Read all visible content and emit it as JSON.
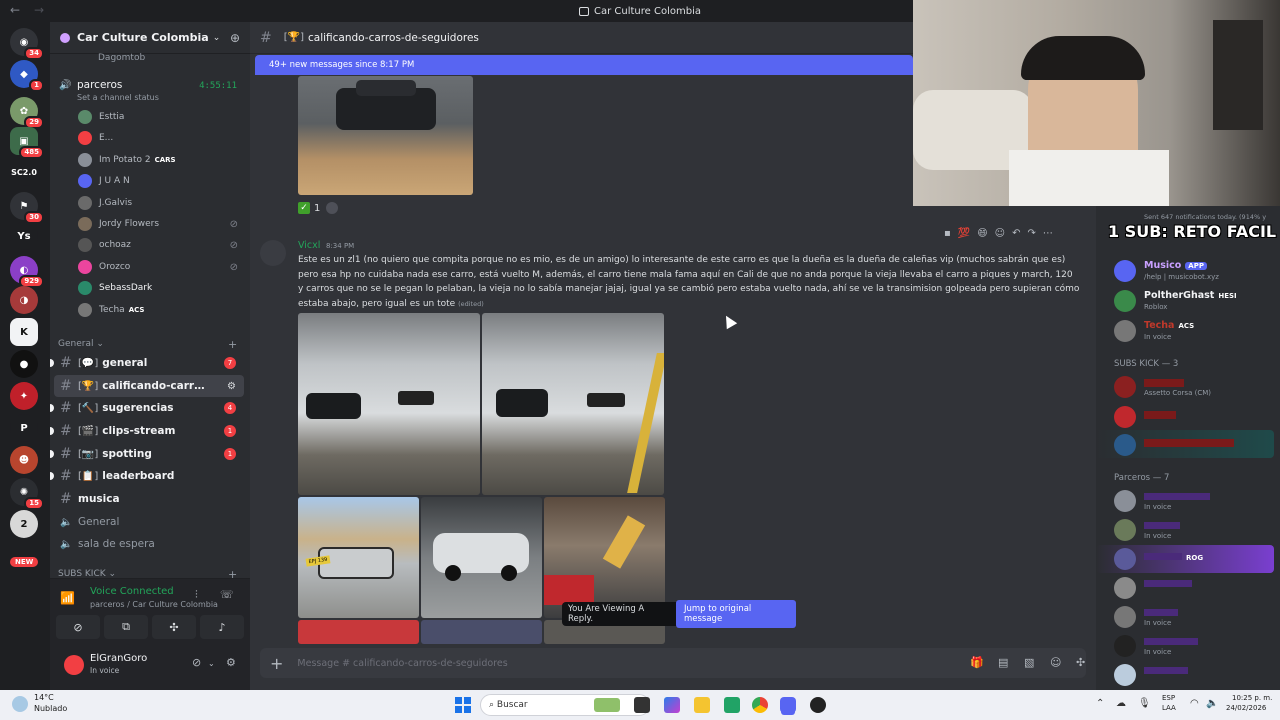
{
  "window": {
    "title": "Car Culture Colombia"
  },
  "guilds": {
    "badges": [
      "34",
      "1",
      "29",
      "485",
      "30",
      "929",
      "15"
    ],
    "labels": {
      "sc": "SC2.0",
      "ys": "Ys",
      "p": "P"
    },
    "new_label": "NEW"
  },
  "server": {
    "name": "Car Culture Colombia",
    "top_user": "Dagomtob",
    "voice_channel": {
      "name": "parceros",
      "status": "Set a channel status",
      "timer": "4:55:11"
    },
    "voice_users": [
      {
        "name": "Esttia",
        "badge": ""
      },
      {
        "name": "E...",
        "badge": ""
      },
      {
        "name": "Im Potato 2",
        "badge": "CARS"
      },
      {
        "name": "J U A N",
        "badge": ""
      },
      {
        "name": "J.Galvis",
        "badge": ""
      },
      {
        "name": "Jordy Flowers",
        "badge": ""
      },
      {
        "name": "ochoaz",
        "badge": ""
      },
      {
        "name": "Orozco",
        "badge": ""
      },
      {
        "name": "SebassDark",
        "badge": ""
      },
      {
        "name": "Techa",
        "badge": "ACS"
      }
    ],
    "category_general": "General",
    "category_subs": "SUBS KICK",
    "channels": [
      {
        "name": "general",
        "unread": "7"
      },
      {
        "name": "calificando-carros...",
        "unread": ""
      },
      {
        "name": "sugerencias",
        "unread": "4"
      },
      {
        "name": "clips-stream",
        "unread": "1"
      },
      {
        "name": "spotting",
        "unread": "1"
      },
      {
        "name": "leaderboard",
        "unread": ""
      },
      {
        "name": "musica",
        "unread": ""
      }
    ],
    "voice_channels": [
      "General",
      "sala de espera"
    ]
  },
  "voice_panel": {
    "status": "Voice Connected",
    "location": "parceros / Car Culture Colombia"
  },
  "user_panel": {
    "name": "ElGranGoro",
    "status": "In voice"
  },
  "chat": {
    "channel": "calificando-carros-de-seguidores",
    "new_messages": "49+ new messages since 8:17 PM",
    "reaction_count": "1",
    "message": {
      "author": "Vicxl",
      "time": "8:34 PM",
      "text": "Este es un zl1 (no quiero que compita porque no es mio, es de un amigo) lo interesante de este carro es que la dueña es la dueña de caleñas vip (muchos sabrán que es) pero esa hp no cuidaba nada ese carro, está vuelto M, además, el carro tiene mala fama aquí en Cali de que no anda porque la vieja llevaba el carro a piques y march, 120 y carros que no se le pegan lo pelaban, la vieja no lo sabía manejar jajaj, igual ya se cambió pero estaba vuelto nada, ahí se ve la transimision golpeada pero supieran cómo estaba abajo, pero igual es un tote",
      "edited": "(edited)"
    },
    "plate_text": "EPJ 139",
    "reply_bar": {
      "label": "You Are Viewing A Reply.",
      "button": "Jump to original message"
    },
    "composer_placeholder": "Message #  calificando-carros-de-seguidores"
  },
  "members": {
    "top_status": "Sent 647 notifications today. (914% y",
    "overlay_text": "1 SUB: RETO FACIL",
    "list": [
      {
        "name": "Musico",
        "badge": "APP",
        "sub": "/help | musicobot.xyz",
        "color": "#c9a0ff"
      },
      {
        "name": "PoltherGhast",
        "badge": "HESI",
        "sub": "Roblox",
        "color": "#f2f3f5"
      },
      {
        "name": "Techa",
        "badge": "ACS",
        "sub": "In voice",
        "color": "#c0392b"
      }
    ],
    "group_subs": "SUBS KICK — 3",
    "subs": [
      {
        "sub": "Assetto Corsa (CM)"
      }
    ],
    "group_parceros": "Parceros — 7",
    "parceros_sub": "In voice",
    "badge_rog": "ROG"
  },
  "taskbar": {
    "temp": "14°C",
    "weather": "Nublado",
    "search": "Buscar",
    "lang1": "ESP",
    "lang2": "LAA",
    "time": "10:25 p. m.",
    "date": "24/02/2026"
  }
}
